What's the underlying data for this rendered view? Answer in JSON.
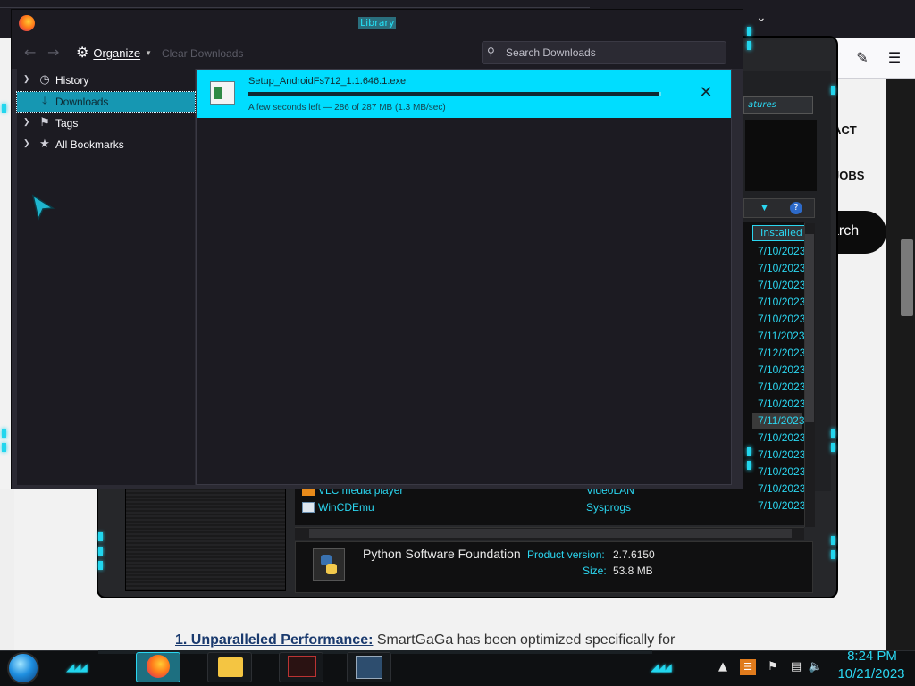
{
  "library": {
    "title": "Library",
    "toolbar": {
      "back_icon": "arrow-left-icon",
      "forward_icon": "arrow-right-icon",
      "organize_label": "Organize",
      "clear_downloads_label": "Clear Downloads",
      "search_placeholder": "Search Downloads"
    },
    "sidebar": {
      "items": [
        {
          "label": "History",
          "icon": "clock-icon",
          "expandable": true
        },
        {
          "label": "Downloads",
          "icon": "download-icon",
          "expandable": false,
          "selected": true
        },
        {
          "label": "Tags",
          "icon": "tag-icon",
          "expandable": true
        },
        {
          "label": "All Bookmarks",
          "icon": "star-icon",
          "expandable": true
        }
      ]
    },
    "download": {
      "filename": "Setup_AndroidFs712_1.1.646.1.exe",
      "status": "A few seconds left — 286 of 287 MB (1.3 MB/sec)",
      "progress": 0.996
    }
  },
  "program_manager": {
    "features_label": "atures",
    "column_header": "Installed",
    "dates": [
      "7/10/2023",
      "7/10/2023",
      "7/10/2023",
      "7/10/2023",
      "7/10/2023",
      "7/11/2023",
      "7/12/2023",
      "7/10/2023",
      "7/10/2023",
      "7/10/2023",
      "7/11/2023",
      "7/10/2023",
      "7/10/2023",
      "7/10/2023",
      "7/10/2023",
      "7/10/2023"
    ],
    "selected_date_index": 10,
    "rows": [
      {
        "name": "VLC media player",
        "publisher": "VideoLAN"
      },
      {
        "name": "WinCDEmu",
        "publisher": "Sysprogs"
      }
    ],
    "details": {
      "publisher": "Python Software Foundation",
      "product_version_label": "Product version:",
      "product_version": "2.7.6150",
      "size_label": "Size:",
      "size": "53.8 MB"
    }
  },
  "browser_page": {
    "menu_items": [
      "ACT",
      "JOBS"
    ],
    "search_label": "arch",
    "article_bold": "1. Unparalleled Performance:",
    "article_text": " SmartGaGa has been optimized specifically for"
  },
  "taskbar": {
    "time": "8:24 PM",
    "date": "10/21/2023",
    "accent_color": "#22d6ee"
  }
}
